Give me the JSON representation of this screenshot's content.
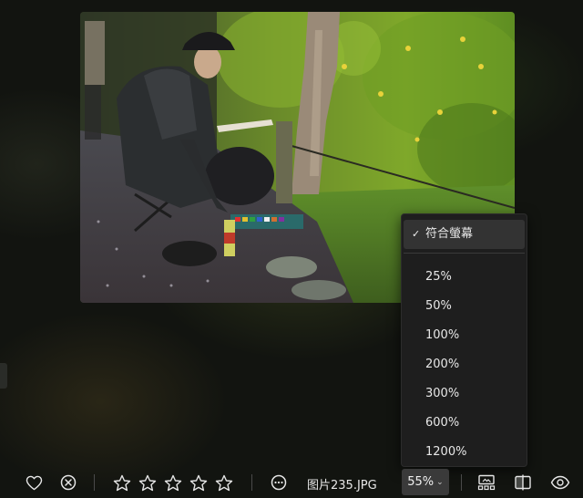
{
  "viewer": {
    "filename": "图片235.JPG",
    "zoom_value": "55%"
  },
  "zoom_menu": {
    "selected_label": "符合螢幕",
    "options": [
      "25%",
      "50%",
      "100%",
      "200%",
      "300%",
      "600%",
      "1200%"
    ]
  },
  "toolbar": {
    "rating_stars": 0,
    "icons": [
      "heart-icon",
      "reject-icon",
      "star-icon",
      "more-icon",
      "filmstrip-icon",
      "compare-icon",
      "eye-icon"
    ]
  }
}
